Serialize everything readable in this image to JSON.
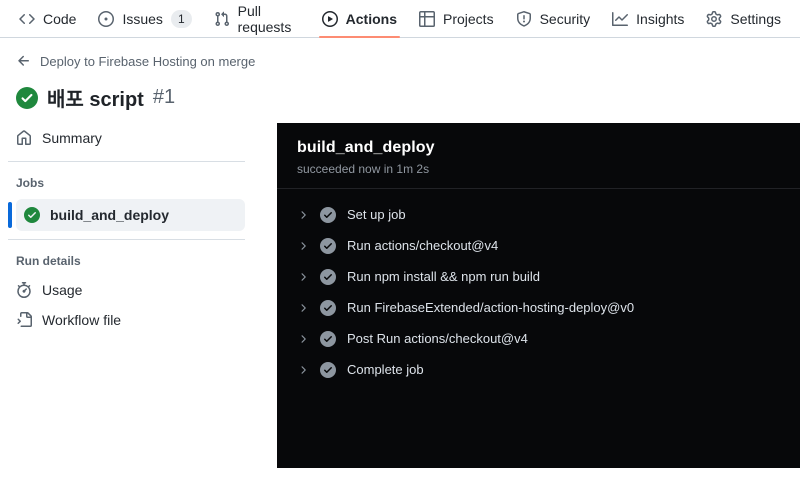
{
  "nav": {
    "items": [
      {
        "label": "Code",
        "icon": "code-icon",
        "active": false
      },
      {
        "label": "Issues",
        "icon": "issue-opened-icon",
        "badge": "1",
        "active": false
      },
      {
        "label": "Pull requests",
        "icon": "git-pull-request-icon",
        "active": false
      },
      {
        "label": "Actions",
        "icon": "play-icon",
        "active": true
      },
      {
        "label": "Projects",
        "icon": "table-icon",
        "active": false
      },
      {
        "label": "Security",
        "icon": "shield-icon",
        "active": false
      },
      {
        "label": "Insights",
        "icon": "graph-icon",
        "active": false
      },
      {
        "label": "Settings",
        "icon": "gear-icon",
        "active": false
      }
    ]
  },
  "header": {
    "breadcrumb": "Deploy to Firebase Hosting on merge",
    "title": "배포 script",
    "run_number": "#1",
    "status": "success"
  },
  "sidebar": {
    "summary_label": "Summary",
    "jobs_section_label": "Jobs",
    "job_name": "build_and_deploy",
    "job_status": "success",
    "run_details_label": "Run details",
    "usage_label": "Usage",
    "workflow_file_label": "Workflow file"
  },
  "log_panel": {
    "job_title": "build_and_deploy",
    "status_line": "succeeded now in 1m 2s",
    "steps": [
      "Set up job",
      "Run actions/checkout@v4",
      "Run npm install && npm run build",
      "Run FirebaseExtended/action-hosting-deploy@v0",
      "Post Run actions/checkout@v4",
      "Complete job"
    ]
  },
  "colors": {
    "tab_underline": "#fd8c73",
    "selected_job_bar": "#0969da",
    "success_green": "#1f883d",
    "panel_background": "#07080a"
  }
}
